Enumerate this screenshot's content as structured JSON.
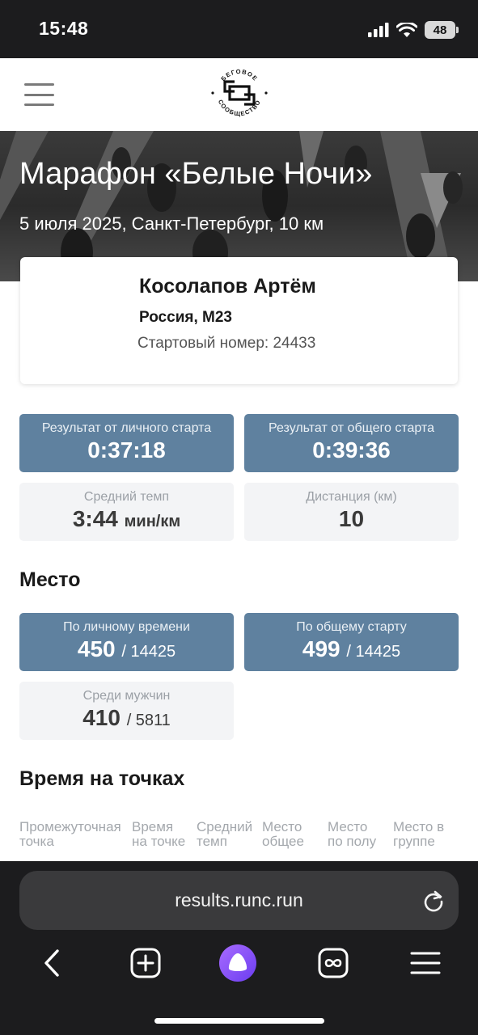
{
  "status_bar": {
    "time": "15:48",
    "battery": "48"
  },
  "header": {
    "logo_text": "БЕГОВОЕ СООБЩЕСТВО"
  },
  "event": {
    "title": "Марафон «Белые Ночи»",
    "subtitle": "5 июля 2025, Санкт-Петербург, 10 км"
  },
  "athlete": {
    "name": "Косолапов Артём",
    "country_group": "Россия, М23",
    "bib": "Стартовый номер: 24433"
  },
  "results": {
    "chip": {
      "label": "Результат от личного старта",
      "value": "0:37:18"
    },
    "gun": {
      "label": "Результат от общего старта",
      "value": "0:39:36"
    },
    "pace": {
      "label": "Средний темп",
      "value": "3:44",
      "unit": "мин/км"
    },
    "distance": {
      "label": "Дистанция (км)",
      "value": "10"
    }
  },
  "place": {
    "title": "Место",
    "chip": {
      "label": "По личному времени",
      "value": "450",
      "total": "/ 14425"
    },
    "gun": {
      "label": "По общему старту",
      "value": "499",
      "total": "/ 14425"
    },
    "men": {
      "label": "Среди мужчин",
      "value": "410",
      "total": "/ 5811"
    }
  },
  "splits": {
    "title": "Время на точках",
    "columns": [
      "Промежуточная\nточка",
      "Время\nна точке",
      "Средний\nтемп",
      "Место\nобщее",
      "Место\nпо полу",
      "Место в\nгруппе"
    ]
  },
  "browser": {
    "url": "results.runc.run"
  },
  "colors": {
    "tile_blue": "#5f819f",
    "tile_grey": "#f3f4f6",
    "assistant": "#8b5cf6"
  }
}
